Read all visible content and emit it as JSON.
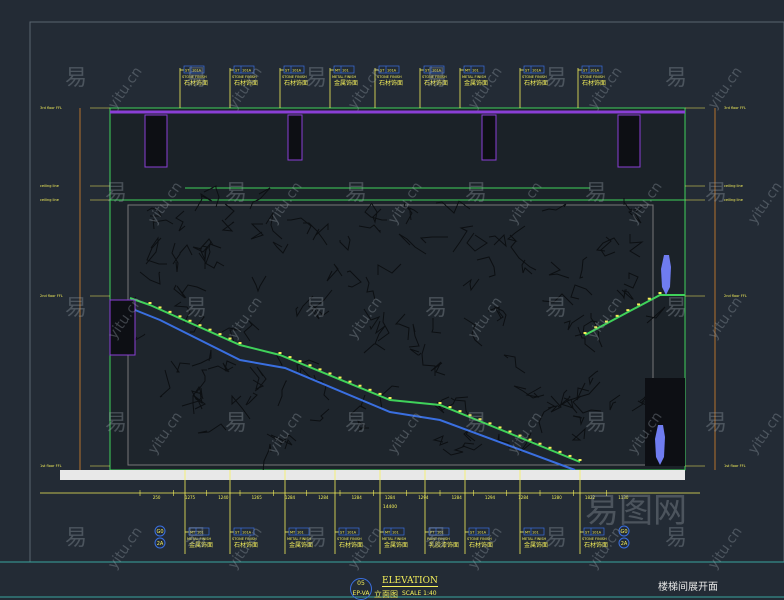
{
  "drawing": {
    "title_en": "ELEVATION",
    "title_cn": "立面图",
    "scale": "SCALE 1:40",
    "ref_number": "05",
    "ref_sheet": "EP-VA",
    "sheet_title": "楼梯间展开面"
  },
  "top_tags": [
    {
      "code": "ST",
      "num": "101A",
      "en": "STONE FINISH",
      "cn": "石材饰面"
    },
    {
      "code": "ST",
      "num": "101A",
      "en": "STONE FINISH",
      "cn": "石材饰面"
    },
    {
      "code": "ST",
      "num": "101A",
      "en": "STONE FINISH",
      "cn": "石材饰面"
    },
    {
      "code": "MT",
      "num": "101",
      "en": "METAL FINISH",
      "cn": "金属饰面"
    },
    {
      "code": "ST",
      "num": "101A",
      "en": "STONE FINISH",
      "cn": "石材饰面"
    },
    {
      "code": "ST",
      "num": "101A",
      "en": "STONE FINISH",
      "cn": "石材饰面"
    },
    {
      "code": "MT",
      "num": "101",
      "en": "METAL FINISH",
      "cn": "金属饰面"
    },
    {
      "code": "ST",
      "num": "101A",
      "en": "STONE FINISH",
      "cn": "石材饰面"
    },
    {
      "code": "ST",
      "num": "101A",
      "en": "STONE FINISH",
      "cn": "石材饰面"
    }
  ],
  "bottom_tags": [
    {
      "code": "MT",
      "num": "101",
      "en": "METAL FINISH",
      "cn": "金属饰面"
    },
    {
      "code": "ST",
      "num": "101A",
      "en": "STONE FINISH",
      "cn": "石材饰面"
    },
    {
      "code": "MT",
      "num": "101",
      "en": "METAL FINISH",
      "cn": "金属饰面"
    },
    {
      "code": "ST",
      "num": "101A",
      "en": "STONE FINISH",
      "cn": "石材饰面"
    },
    {
      "code": "MT",
      "num": "101",
      "en": "METAL FINISH",
      "cn": "金属饰面"
    },
    {
      "code": "PT",
      "num": "101",
      "en": "PAINT FINISH",
      "cn": "乳胶漆饰面"
    },
    {
      "code": "ST",
      "num": "101A",
      "en": "STONE FINISH",
      "cn": "石材饰面"
    },
    {
      "code": "MT",
      "num": "101",
      "en": "METAL FINISH",
      "cn": "金属饰面"
    },
    {
      "code": "ST",
      "num": "101A",
      "en": "STONE FINISH",
      "cn": "石材饰面"
    }
  ],
  "section_marks": {
    "left_top": "G0",
    "left_bottom": "2A",
    "right_top": "G0",
    "right_bottom": "2A"
  },
  "levels_left": [
    "3rd floor FFL",
    "ceiling line",
    "ceiling line",
    "2nd floor FFL",
    "1st floor FFL"
  ],
  "levels_right": [
    "3rd floor FFL",
    "ceiling line",
    "ceiling line",
    "2nd floor FFL",
    "1st floor FFL"
  ],
  "dimensions": [
    "250",
    "1275",
    "1240",
    "1265",
    "1284",
    "1284",
    "1284",
    "1284",
    "1294",
    "1284",
    "1294",
    "1284",
    "1280",
    "1822",
    "1130"
  ],
  "total_dimension": "14400",
  "watermark": [
    "易",
    "yitu.cn",
    "易图网"
  ],
  "colors": {
    "bg": "#232b35",
    "yellow": "#f5f05a",
    "green": "#3fd15a",
    "purple": "#8a3fd6",
    "blue": "#3a6fe0",
    "orange": "#d9862c",
    "white": "#e8e8e8"
  }
}
